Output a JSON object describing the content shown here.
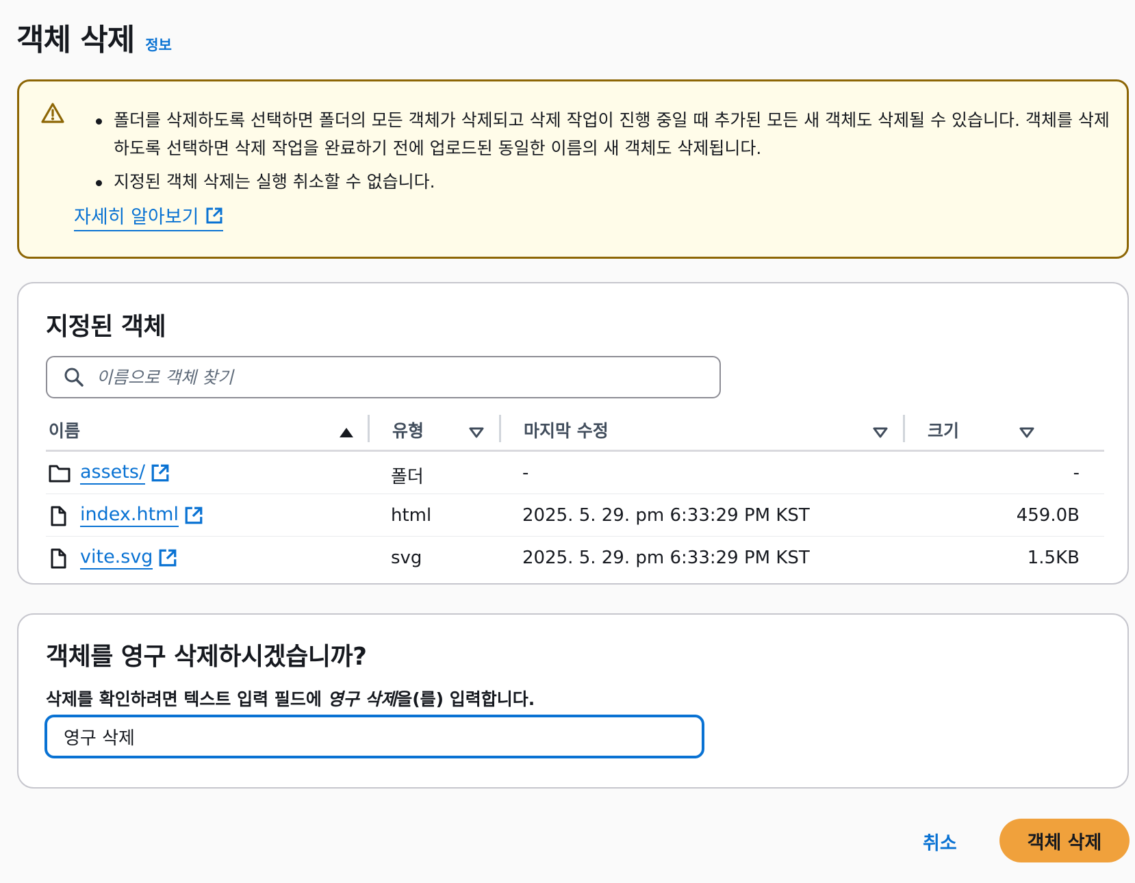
{
  "header": {
    "title": "객체 삭제",
    "info": "정보"
  },
  "warning": {
    "bullets": [
      "폴더를 삭제하도록 선택하면 폴더의 모든 객체가 삭제되고 삭제 작업이 진행 중일 때 추가된 모든 새 객체도 삭제될 수 있습니다. 객체를 삭제하도록 선택하면 삭제 작업을 완료하기 전에 업로드된 동일한 이름의 새 객체도 삭제됩니다.",
      "지정된 객체 삭제는 실행 취소할 수 없습니다."
    ],
    "learn_more": "자세히 알아보기",
    "accent_color": "#8d6605"
  },
  "objects": {
    "title": "지정된 객체",
    "search_placeholder": "이름으로 객체 찾기",
    "columns": [
      "이름",
      "유형",
      "마지막 수정",
      "크기"
    ],
    "rows": [
      {
        "icon": "folder-icon",
        "name": "assets/",
        "type": "폴더",
        "modified": "-",
        "size": "-"
      },
      {
        "icon": "file-icon",
        "name": "index.html",
        "type": "html",
        "modified": "2025. 5. 29. pm 6:33:29 PM KST",
        "size": "459.0B"
      },
      {
        "icon": "file-icon",
        "name": "vite.svg",
        "type": "svg",
        "modified": "2025. 5. 29. pm 6:33:29 PM KST",
        "size": "1.5KB"
      }
    ]
  },
  "confirm": {
    "title": "객체를 영구 삭제하시겠습니까?",
    "label_pre": "삭제를 확인하려면 텍스트 입력 필드에 ",
    "label_em": "영구 삭제",
    "label_post": "을(를) 입력합니다.",
    "input_value": "영구 삭제"
  },
  "footer": {
    "cancel": "취소",
    "delete": "객체 삭제",
    "delete_color": "#f0a13c",
    "link_color": "#0972d3"
  }
}
